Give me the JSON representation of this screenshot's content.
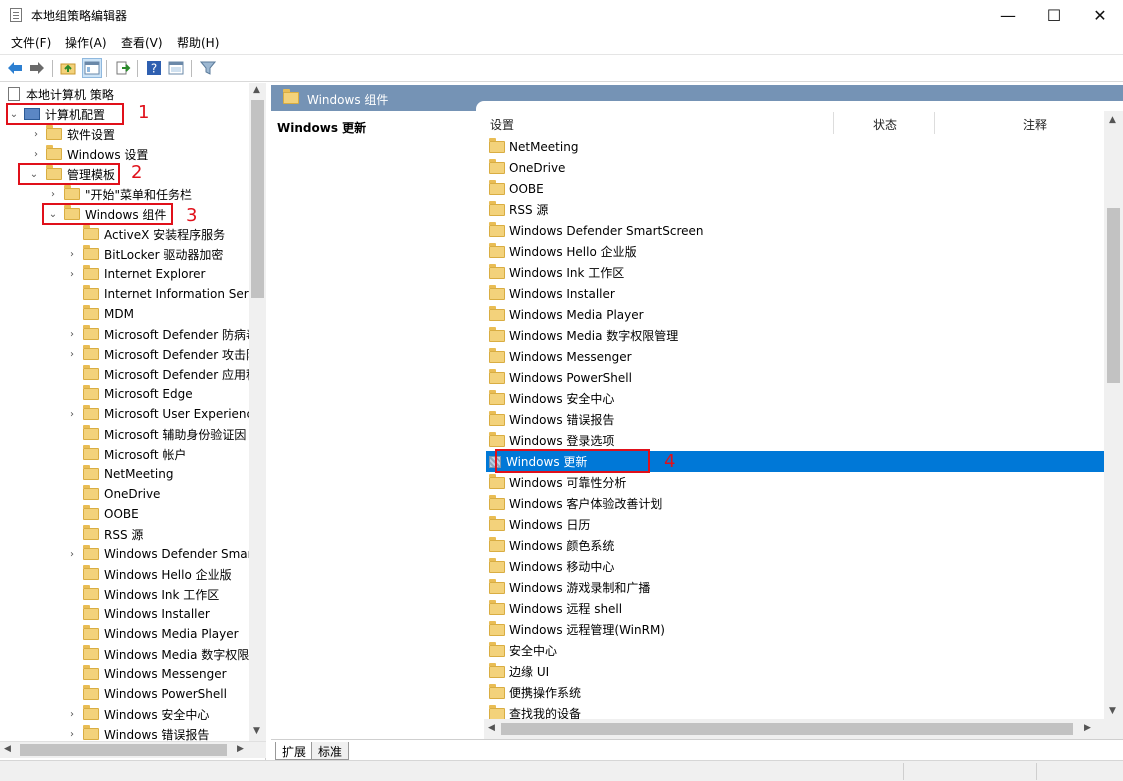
{
  "window": {
    "title": "本地组策略编辑器",
    "controls": {
      "minimize": "—",
      "maximize": "☐",
      "close": "✕"
    }
  },
  "menu": [
    "文件(F)",
    "操作(A)",
    "查看(V)",
    "帮助(H)"
  ],
  "toolbar_icons": [
    "back-arrow-icon",
    "forward-arrow-icon",
    "up-folder-icon",
    "show-hide-tree-icon",
    "export-list-icon",
    "help-icon",
    "properties-icon",
    "filter-icon"
  ],
  "tree": {
    "root": "本地计算机 策略",
    "computer_config": "计算机配置",
    "software_settings": "软件设置",
    "windows_settings": "Windows 设置",
    "admin_templates": "管理模板",
    "start_menu": "\"开始\"菜单和任务栏",
    "windows_components": "Windows 组件",
    "items": [
      {
        "label": "ActiveX 安装程序服务",
        "expandable": false
      },
      {
        "label": "BitLocker 驱动器加密",
        "expandable": true
      },
      {
        "label": "Internet Explorer",
        "expandable": true
      },
      {
        "label": "Internet Information Servi",
        "expandable": false
      },
      {
        "label": "MDM",
        "expandable": false
      },
      {
        "label": "Microsoft Defender 防病毒",
        "expandable": true
      },
      {
        "label": "Microsoft Defender 攻击防",
        "expandable": true
      },
      {
        "label": "Microsoft Defender 应用程",
        "expandable": false
      },
      {
        "label": "Microsoft Edge",
        "expandable": false
      },
      {
        "label": "Microsoft User Experience",
        "expandable": true
      },
      {
        "label": "Microsoft 辅助身份验证因",
        "expandable": false
      },
      {
        "label": "Microsoft 帐户",
        "expandable": false
      },
      {
        "label": "NetMeeting",
        "expandable": false
      },
      {
        "label": "OneDrive",
        "expandable": false
      },
      {
        "label": "OOBE",
        "expandable": false
      },
      {
        "label": "RSS 源",
        "expandable": false
      },
      {
        "label": "Windows Defender Smar",
        "expandable": true
      },
      {
        "label": "Windows Hello 企业版",
        "expandable": false
      },
      {
        "label": "Windows Ink 工作区",
        "expandable": false
      },
      {
        "label": "Windows Installer",
        "expandable": false
      },
      {
        "label": "Windows Media Player",
        "expandable": false
      },
      {
        "label": "Windows Media 数字权限",
        "expandable": false
      },
      {
        "label": "Windows Messenger",
        "expandable": false
      },
      {
        "label": "Windows PowerShell",
        "expandable": false
      },
      {
        "label": "Windows 安全中心",
        "expandable": true
      },
      {
        "label": "Windows 错误报告",
        "expandable": true
      }
    ]
  },
  "annotations": [
    "1",
    "2",
    "3",
    "4"
  ],
  "right": {
    "header": "Windows 组件",
    "desc_title": "Windows 更新",
    "columns": [
      "设置",
      "状态",
      "注释"
    ],
    "rows": [
      "NetMeeting",
      "OneDrive",
      "OOBE",
      "RSS 源",
      "Windows Defender SmartScreen",
      "Windows Hello 企业版",
      "Windows Ink 工作区",
      "Windows Installer",
      "Windows Media Player",
      "Windows Media 数字权限管理",
      "Windows Messenger",
      "Windows PowerShell",
      "Windows 安全中心",
      "Windows 错误报告",
      "Windows 登录选项",
      "Windows 更新",
      "Windows 可靠性分析",
      "Windows 客户体验改善计划",
      "Windows 日历",
      "Windows 颜色系统",
      "Windows 移动中心",
      "Windows 游戏录制和广播",
      "Windows 远程 shell",
      "Windows 远程管理(WinRM)",
      "安全中心",
      "边缘 UI",
      "便携操作系统",
      "查找我的设备"
    ],
    "selected_index": 15
  },
  "tabs": [
    "扩展",
    "标准"
  ],
  "colors": {
    "selection": "#0078d7",
    "header": "#7593b5",
    "annotation": "#e0101a"
  }
}
